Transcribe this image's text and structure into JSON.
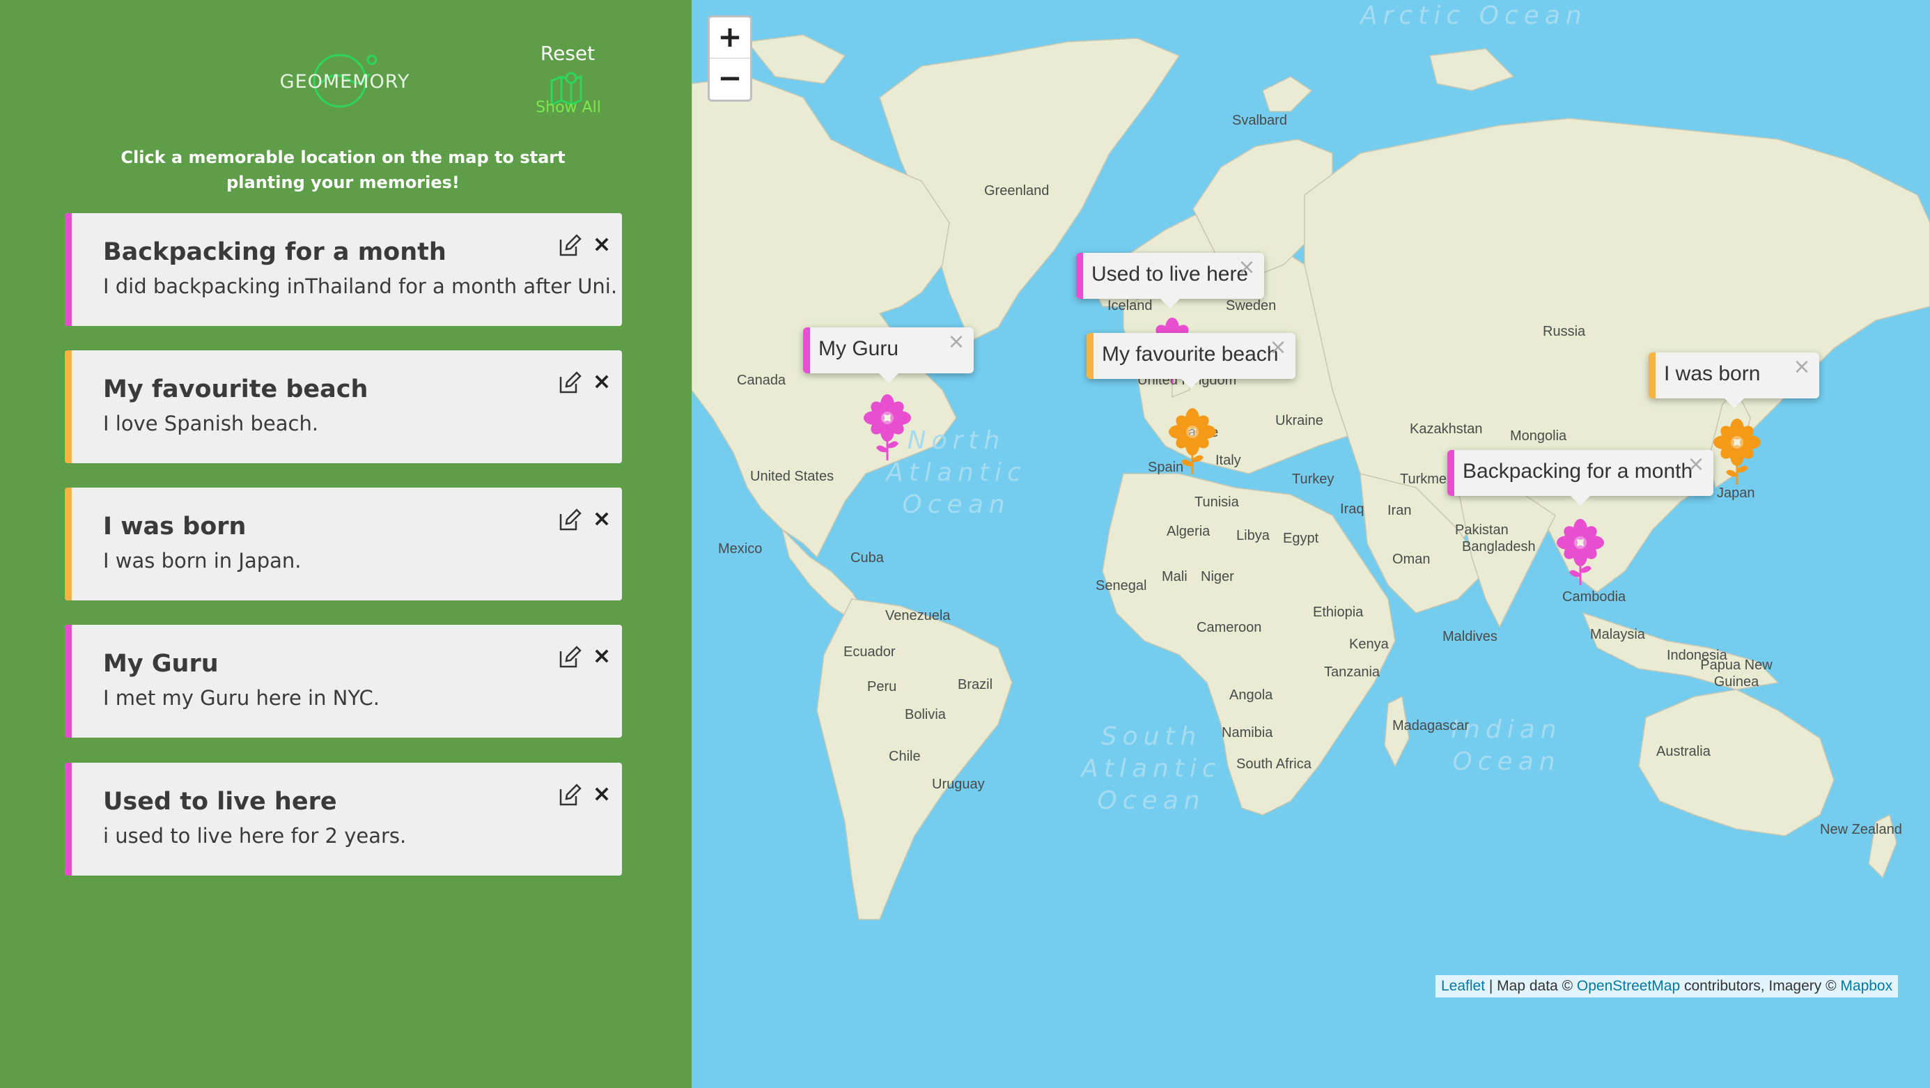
{
  "sidebar": {
    "logo_text": "GEOMEMORY",
    "reset_label": "Reset",
    "show_all_label": "Show All",
    "instructions": "Click a memorable location on the map to start planting your memories!",
    "memories": [
      {
        "title": "Backpacking for a month",
        "description": "I did backpacking inThailand for a month after Uni.",
        "color": "#e84fd0"
      },
      {
        "title": "My favourite beach",
        "description": "I love Spanish beach.",
        "color": "#f5b342"
      },
      {
        "title": "I was born",
        "description": "I was born in Japan.",
        "color": "#f5b342"
      },
      {
        "title": "My Guru",
        "description": "I met my Guru here in NYC.",
        "color": "#e84fd0"
      },
      {
        "title": "Used to live here",
        "description": "i used to live here for 2 years.",
        "color": "#e84fd0"
      }
    ]
  },
  "map": {
    "zoom_in": "+",
    "zoom_out": "−",
    "popups": [
      {
        "text": "Used to live here",
        "color": "#e84fd0"
      },
      {
        "text": "My Guru",
        "color": "#e84fd0"
      },
      {
        "text": "My favourite beach",
        "color": "#f5b342"
      },
      {
        "text": "I was born",
        "color": "#f5b342"
      },
      {
        "text": "Backpacking for a month",
        "color": "#e84fd0"
      }
    ],
    "country_labels": [
      "Svalbard",
      "Greenland",
      "Iceland",
      "Sweden",
      "Russia",
      "Canada",
      "United Kingdom",
      "France",
      "Ukraine",
      "Kazakhstan",
      "Mongolia",
      "United States",
      "Spain",
      "Italy",
      "Turkey",
      "Turkmenistan",
      "Japan",
      "Iraq",
      "Iran",
      "Pakistan",
      "Tunisia",
      "Algeria",
      "Libya",
      "Egypt",
      "Oman",
      "Bangladesh",
      "Mexico",
      "Cuba",
      "Mali",
      "Niger",
      "Senegal",
      "Ethiopia",
      "Cambodia",
      "Venezuela",
      "Cameroon",
      "Kenya",
      "Maldives",
      "Malaysia",
      "Indonesia",
      "Papua New Guinea",
      "Ecuador",
      "Peru",
      "Brazil",
      "Tanzania",
      "Bolivia",
      "Angola",
      "Madagascar",
      "Chile",
      "Namibia",
      "South Africa",
      "Uruguay",
      "Australia",
      "New Zealand"
    ],
    "ocean_labels": [
      "Arctic Ocean",
      "North Atlantic Ocean",
      "South Atlantic Ocean",
      "Indian Ocean"
    ],
    "attribution": {
      "leaflet": "Leaflet",
      "mid": " | Map data © ",
      "osm": "OpenStreetMap",
      "mid2": " contributors, Imagery © ",
      "mapbox": "Mapbox"
    }
  }
}
